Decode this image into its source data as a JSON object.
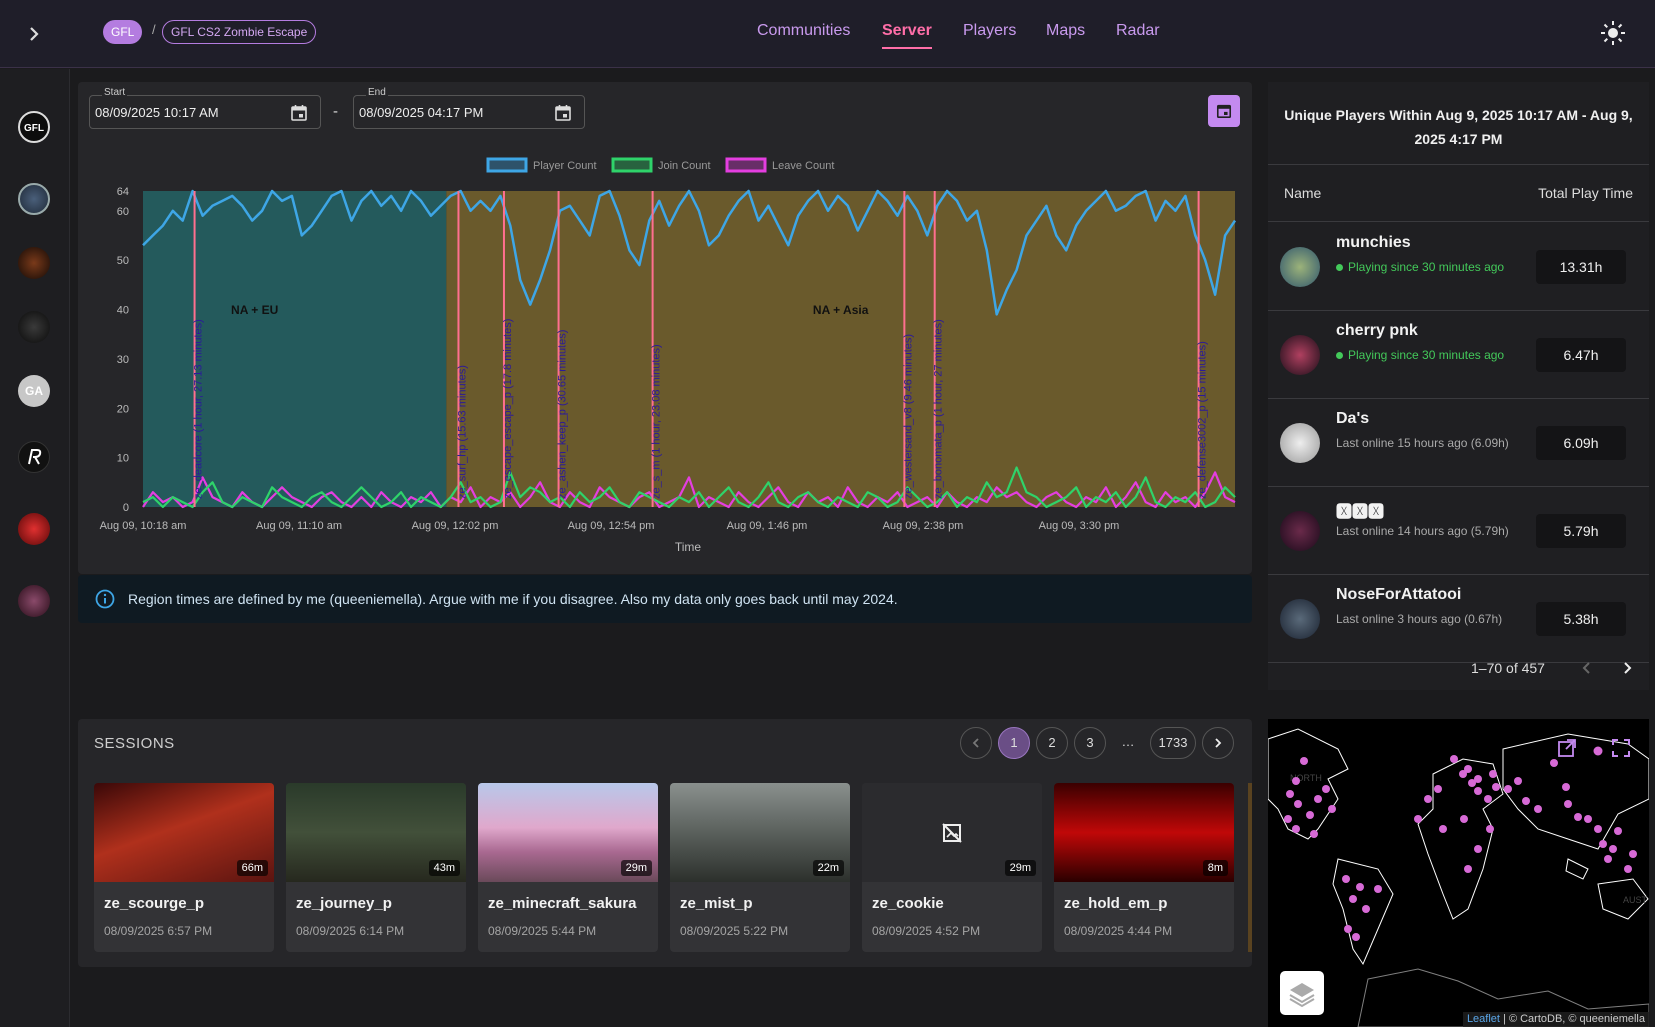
{
  "breadcrumb": {
    "community": "GFL",
    "separator": "/",
    "server": "GFL CS2 Zombie Escape"
  },
  "nav": {
    "communities": "Communities",
    "server": "Server",
    "players": "Players",
    "maps": "Maps",
    "radar": "Radar"
  },
  "sidebar": {
    "items": [
      {
        "icon": "gfl-logo",
        "text": ""
      },
      {
        "icon": "team-logo",
        "text": ""
      },
      {
        "icon": "community-logo",
        "text": ""
      },
      {
        "icon": "community-logo",
        "text": ""
      },
      {
        "icon": "initials",
        "text": "GA"
      },
      {
        "icon": "r-logo",
        "text": ""
      },
      {
        "icon": "community-logo",
        "text": ""
      },
      {
        "icon": "community-logo",
        "text": ""
      }
    ]
  },
  "range": {
    "start_label": "Start",
    "start_value": "08/09/2025 10:17 AM",
    "separator": "-",
    "end_label": "End",
    "end_value": "08/09/2025 04:17 PM"
  },
  "chart_data": {
    "type": "line",
    "xlabel": "Time",
    "ylabel": "",
    "ylim": [
      0,
      64
    ],
    "yticks": [
      0,
      10,
      20,
      30,
      40,
      50,
      60,
      64
    ],
    "xticks": [
      "Aug 09, 10:18 am",
      "Aug 09, 11:10 am",
      "Aug 09, 12:02 pm",
      "Aug 09, 12:54 pm",
      "Aug 09, 1:46 pm",
      "Aug 09, 2:38 pm",
      "Aug 09, 3:30 pm"
    ],
    "legend": {
      "position": "top-center",
      "entries": [
        "Player Count",
        "Join Count",
        "Leave Count"
      ]
    },
    "colors": {
      "player": "#3ea6e6",
      "join": "#2fd36a",
      "leave": "#e43ee0",
      "region_eu": "#245a5c",
      "region_asia": "#6a5a2c",
      "marker": "#ff6f8f",
      "label": "#2b1a9a"
    },
    "regions": [
      {
        "label": "NA + EU",
        "start_min": 0,
        "end_min": 100
      },
      {
        "label": "NA + Asia",
        "start_min": 100,
        "end_min": 360
      }
    ],
    "map_changes": [
      {
        "min": 17,
        "label": "ze_deadcore (1 hour, 27.13 minutes)"
      },
      {
        "min": 104,
        "label": "ze_surf_hp (15.63 minutes)"
      },
      {
        "min": 119,
        "label": "ze_escape_escape_p (17.8 minutes)"
      },
      {
        "min": 137,
        "label": "ze_ashen_keep_p (30.65 minutes)"
      },
      {
        "min": 168,
        "label": "ze_s_m (1 hour, 23.08 minutes)"
      },
      {
        "min": 251,
        "label": "ze_westersand_v8 (9.46 minutes)"
      },
      {
        "min": 261,
        "label": "ze_bonomata_p (1 hour, 27 minutes)"
      },
      {
        "min": 348,
        "label": "ze_defense3002_p (15 minutes)"
      }
    ],
    "series": [
      {
        "name": "Player Count",
        "values": [
          53,
          55,
          57,
          60,
          58,
          64,
          59,
          61,
          62,
          63,
          61,
          58,
          60,
          64,
          62,
          63,
          55,
          57,
          60,
          63,
          64,
          58,
          62,
          64,
          61,
          63,
          60,
          64,
          62,
          59,
          61,
          63,
          64,
          60,
          62,
          60,
          63,
          57,
          46,
          41,
          46,
          52,
          60,
          61,
          58,
          55,
          63,
          64,
          59,
          52,
          49,
          58,
          62,
          57,
          61,
          64,
          60,
          53,
          55,
          59,
          62,
          64,
          58,
          61,
          57,
          53,
          59,
          62,
          64,
          60,
          63,
          61,
          56,
          60,
          64,
          62,
          59,
          63,
          60,
          55,
          61,
          64,
          62,
          58,
          60,
          52,
          39,
          44,
          48,
          55,
          58,
          61,
          55,
          52,
          57,
          60,
          62,
          64,
          60,
          61,
          63,
          64,
          58,
          62,
          60,
          63,
          55,
          50,
          43,
          55,
          58
        ]
      },
      {
        "name": "Join Count",
        "values": [
          1,
          2,
          0,
          2,
          1,
          0,
          3,
          5,
          1,
          0,
          2,
          1,
          0,
          4,
          2,
          1,
          0,
          2,
          3,
          1,
          0,
          2,
          4,
          2,
          0,
          1,
          3,
          0,
          2,
          1,
          0,
          2,
          5,
          1,
          2,
          0,
          1,
          7,
          2,
          4,
          3,
          1,
          2,
          0,
          3,
          1,
          2,
          4,
          1,
          0,
          3,
          2,
          1,
          0,
          2,
          1,
          3,
          0,
          2,
          4,
          1,
          0,
          2,
          5,
          1,
          0,
          2,
          3,
          1,
          0,
          2,
          1,
          0,
          3,
          2,
          0,
          1,
          4,
          2,
          0,
          1,
          3,
          0,
          2,
          1,
          5,
          2,
          3,
          8,
          3,
          2,
          0,
          1,
          2,
          4,
          0,
          2,
          1,
          3,
          0,
          2,
          6,
          1,
          0,
          2,
          1,
          3,
          0,
          1,
          4,
          2
        ]
      },
      {
        "name": "Leave Count",
        "values": [
          0,
          3,
          1,
          2,
          0,
          1,
          6,
          2,
          1,
          0,
          3,
          1,
          0,
          2,
          4,
          2,
          1,
          0,
          2,
          3,
          1,
          0,
          2,
          0,
          3,
          1,
          0,
          2,
          1,
          3,
          0,
          2,
          1,
          4,
          0,
          2,
          1,
          3,
          0,
          2,
          5,
          1,
          0,
          3,
          1,
          0,
          4,
          2,
          1,
          0,
          2,
          3,
          0,
          1,
          2,
          6,
          0,
          2,
          1,
          0,
          3,
          1,
          0,
          2,
          4,
          1,
          0,
          3,
          1,
          2,
          0,
          4,
          1,
          0,
          2,
          1,
          3,
          0,
          1,
          2,
          0,
          3,
          1,
          0,
          2,
          1,
          4,
          2,
          3,
          1,
          0,
          2,
          3,
          1,
          0,
          2,
          1,
          4,
          0,
          2,
          5,
          1,
          0,
          3,
          1,
          2,
          0,
          3,
          7,
          2,
          1
        ]
      }
    ]
  },
  "info": {
    "text": "Region times are defined by me (queeniemella). Argue with me if you disagree. Also my data only goes back until may 2024."
  },
  "unique_players": {
    "title": "Unique Players Within Aug 9, 2025 10:17 AM - Aug 9, 2025 4:17 PM",
    "col_name": "Name",
    "col_time": "Total Play Time",
    "rows": [
      {
        "name": "munchies",
        "status": "Playing since 30 minutes ago",
        "time": "13.31h",
        "online": true
      },
      {
        "name": "cherry pnk",
        "status": "Playing since 30 minutes ago",
        "time": "6.47h",
        "online": true
      },
      {
        "name": "Da's",
        "status": "Last online 15 hours ago (6.09h)",
        "time": "6.09h",
        "online": false
      },
      {
        "name": "🆇🆇🆇",
        "status": "Last online 14 hours ago (5.79h)",
        "time": "5.79h",
        "online": false
      },
      {
        "name": "NoseForAttatooi",
        "status": "Last online 3 hours ago (0.67h)",
        "time": "5.38h",
        "online": false
      }
    ],
    "pagination": "1–70 of 457"
  },
  "sessions": {
    "title": "SESSIONS",
    "pages": [
      "1",
      "2",
      "3",
      "…",
      "1733"
    ],
    "cards": [
      {
        "map": "ze_scourge_p",
        "date": "08/09/2025 6:57 PM",
        "duration": "66m"
      },
      {
        "map": "ze_journey_p",
        "date": "08/09/2025 6:14 PM",
        "duration": "43m"
      },
      {
        "map": "ze_minecraft_sakura",
        "date": "08/09/2025 5:44 PM",
        "duration": "29m"
      },
      {
        "map": "ze_mist_p",
        "date": "08/09/2025 5:22 PM",
        "duration": "22m"
      },
      {
        "map": "ze_cookie",
        "date": "08/09/2025 4:52 PM",
        "duration": "29m"
      },
      {
        "map": "ze_hold_em_p",
        "date": "08/09/2025 4:44 PM",
        "duration": "8m"
      }
    ]
  },
  "map": {
    "attr_leaflet": "Leaflet",
    "attr_rest": "| © CartoDB, © queeniemella",
    "label_north": "NORTH",
    "label_aust": "AUST"
  }
}
